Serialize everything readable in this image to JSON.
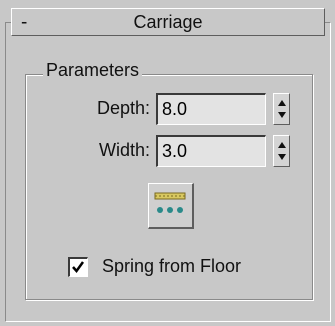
{
  "rollout": {
    "collapse_symbol": "-",
    "title": "Carriage"
  },
  "parameters": {
    "group_title": "Parameters",
    "depth": {
      "label": "Depth:",
      "value": "8.0"
    },
    "width": {
      "label": "Width:",
      "value": "3.0"
    },
    "icon_button": {
      "icon": "carriage-stringer-icon"
    },
    "spring_from_floor": {
      "label": "Spring from Floor",
      "checked": true
    }
  }
}
